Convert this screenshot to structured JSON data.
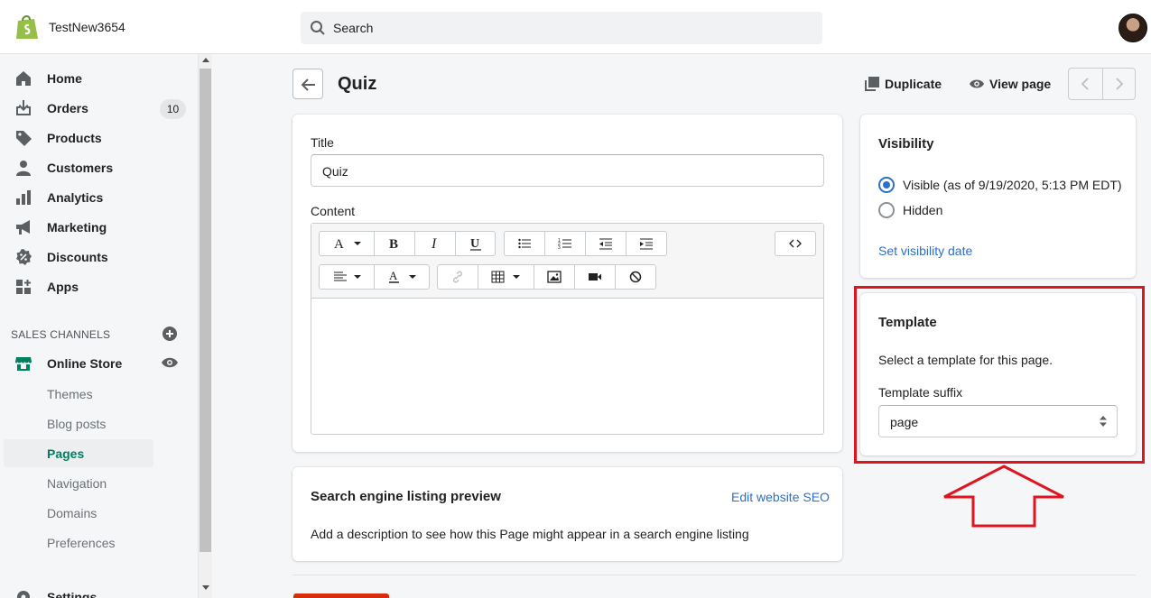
{
  "topbar": {
    "store_name": "TestNew3654",
    "search_placeholder": "Search",
    "logo_icon": "shopify-bag-icon",
    "brand_color": "#95bf47"
  },
  "sidebar": {
    "items": [
      {
        "label": "Home",
        "icon": "home-icon"
      },
      {
        "label": "Orders",
        "icon": "orders-icon",
        "badge": "10"
      },
      {
        "label": "Products",
        "icon": "tag-icon"
      },
      {
        "label": "Customers",
        "icon": "customer-icon"
      },
      {
        "label": "Analytics",
        "icon": "analytics-icon"
      },
      {
        "label": "Marketing",
        "icon": "megaphone-icon"
      },
      {
        "label": "Discounts",
        "icon": "discount-icon"
      },
      {
        "label": "Apps",
        "icon": "apps-icon"
      }
    ],
    "sales_channels_label": "SALES CHANNELS",
    "online_store": {
      "label": "Online Store",
      "icon": "store-icon"
    },
    "sub_items": [
      "Themes",
      "Blog posts",
      "Pages",
      "Navigation",
      "Domains",
      "Preferences"
    ],
    "active_sub_item": "Pages",
    "settings_label": "Settings"
  },
  "page": {
    "title": "Quiz",
    "duplicate_label": "Duplicate",
    "view_page_label": "View page"
  },
  "editor_card": {
    "title_label": "Title",
    "title_value": "Quiz",
    "content_label": "Content",
    "content_value": ""
  },
  "seo_card": {
    "heading": "Search engine listing preview",
    "edit_link": "Edit website SEO",
    "description": "Add a description to see how this Page might appear in a search engine listing"
  },
  "visibility_card": {
    "heading": "Visibility",
    "options": [
      {
        "label": "Visible (as of 9/19/2020, 5:13 PM EDT)",
        "selected": true
      },
      {
        "label": "Hidden",
        "selected": false
      }
    ],
    "set_date_link": "Set visibility date"
  },
  "template_card": {
    "heading": "Template",
    "description": "Select a template for this page.",
    "suffix_label": "Template suffix",
    "suffix_value": "page"
  },
  "colors": {
    "link": "#2c6ecb",
    "active_nav": "#008060",
    "annotation": "#e0141e"
  }
}
